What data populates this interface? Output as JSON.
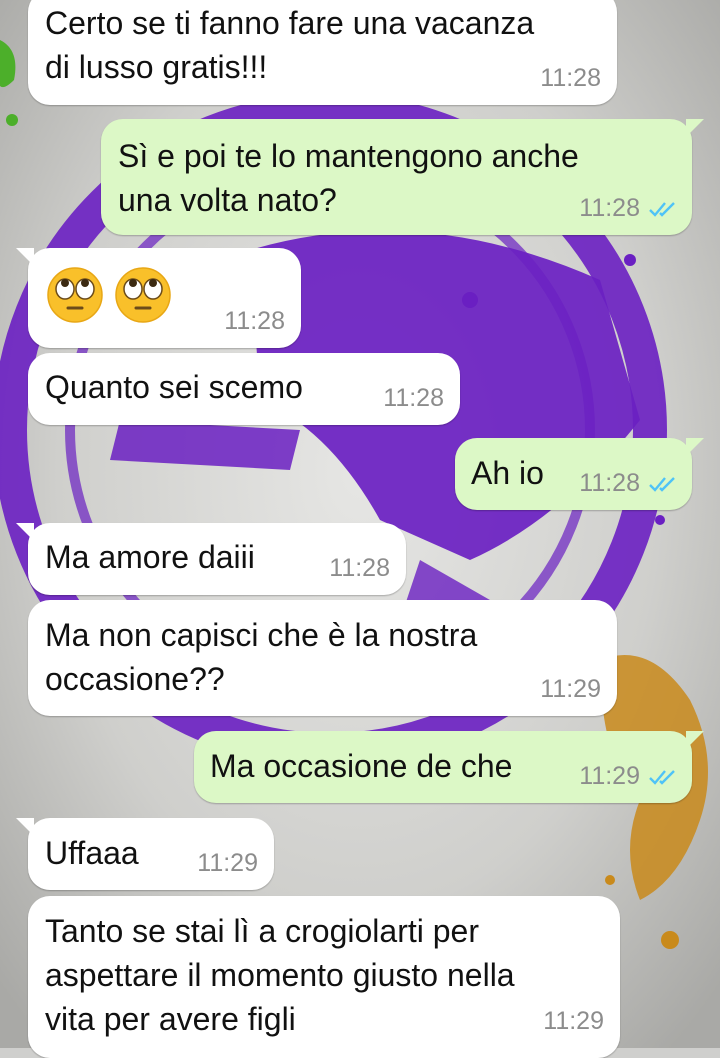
{
  "colors": {
    "incoming_bubble": "#ffffff",
    "outgoing_bubble": "#dcf8c6",
    "read_ticks": "#4fc3f7",
    "timestamp": "#8c8c8c",
    "wallpaper_accent": "#6a1fc2",
    "splash": "#c98a1b"
  },
  "messages": [
    {
      "id": "m1",
      "direction": "incoming",
      "lines": [
        "Certo se ti fanno fare una vacanza",
        "di lusso gratis!!!"
      ],
      "time": "11:28"
    },
    {
      "id": "m2",
      "direction": "outgoing",
      "lines": [
        "Sì e poi te lo mantengono anche",
        "una volta nato?"
      ],
      "time": "11:28",
      "status": "read"
    },
    {
      "id": "m3",
      "direction": "incoming",
      "emojis": [
        "face-with-rolling-eyes",
        "face-with-rolling-eyes"
      ],
      "time": "11:28"
    },
    {
      "id": "m4",
      "direction": "incoming",
      "lines": [
        "Quanto sei scemo"
      ],
      "time": "11:28"
    },
    {
      "id": "m5",
      "direction": "outgoing",
      "lines": [
        "Ah io"
      ],
      "time": "11:28",
      "status": "read"
    },
    {
      "id": "m6",
      "direction": "incoming",
      "lines": [
        "Ma amore daiii"
      ],
      "time": "11:28"
    },
    {
      "id": "m7",
      "direction": "incoming",
      "lines": [
        "Ma non capisci che è la nostra",
        "occasione??"
      ],
      "time": "11:29"
    },
    {
      "id": "m8",
      "direction": "outgoing",
      "lines": [
        "Ma occasione de che"
      ],
      "time": "11:29",
      "status": "read"
    },
    {
      "id": "m9",
      "direction": "incoming",
      "lines": [
        "Uffaaa"
      ],
      "time": "11:29"
    },
    {
      "id": "m10",
      "direction": "incoming",
      "lines": [
        "Tanto se stai lì a crogiolarti per",
        "aspettare il momento giusto nella",
        "vita per avere figli"
      ],
      "time": "11:29"
    }
  ]
}
